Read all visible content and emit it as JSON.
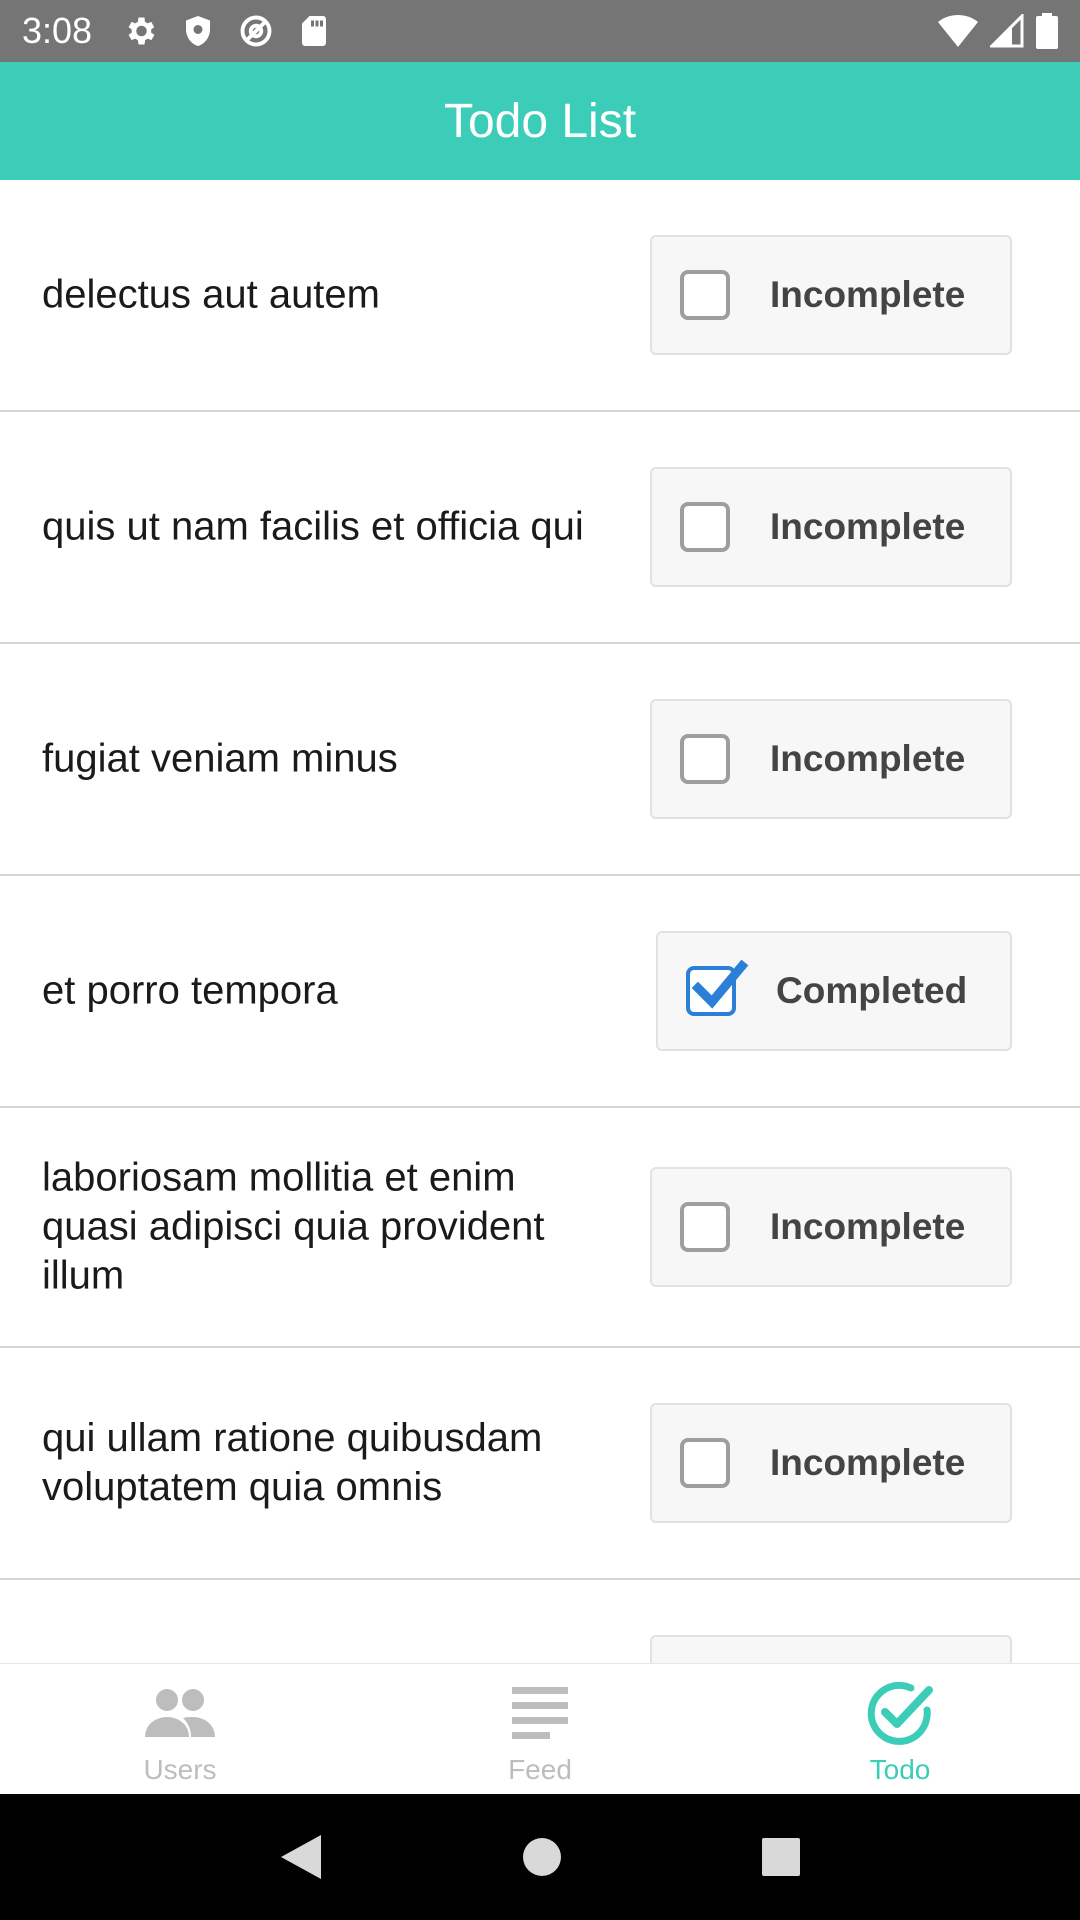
{
  "status_bar": {
    "time": "3:08",
    "left_icons": [
      "settings-icon",
      "shield-icon",
      "at-sign-icon",
      "sd-card-icon"
    ],
    "right_icons": [
      "wifi-icon",
      "cell-signal-icon",
      "battery-icon"
    ]
  },
  "app_bar": {
    "title": "Todo List"
  },
  "todos": [
    {
      "text": "delectus aut autem",
      "status": "Incomplete",
      "completed": false
    },
    {
      "text": "quis ut nam facilis et officia qui",
      "status": "Incomplete",
      "completed": false
    },
    {
      "text": "fugiat veniam minus",
      "status": "Incomplete",
      "completed": false
    },
    {
      "text": "et porro tempora",
      "status": "Completed",
      "completed": true
    },
    {
      "text": "laboriosam mollitia et enim quasi adipisci quia provident illum",
      "status": "Incomplete",
      "completed": false
    },
    {
      "text": "qui ullam ratione quibusdam voluptatem quia omnis",
      "status": "Incomplete",
      "completed": false
    }
  ],
  "bottom_nav": {
    "items": [
      {
        "label": "Users",
        "icon": "users-icon",
        "active": false
      },
      {
        "label": "Feed",
        "icon": "feed-icon",
        "active": false
      },
      {
        "label": "Todo",
        "icon": "todo-check-icon",
        "active": true
      }
    ]
  },
  "colors": {
    "accent": "#3ccdb9",
    "checkbox_checked": "#2b7fd6",
    "status_bar": "#757575"
  },
  "system_nav": {
    "buttons": [
      "back-icon",
      "home-icon",
      "recents-icon"
    ]
  }
}
